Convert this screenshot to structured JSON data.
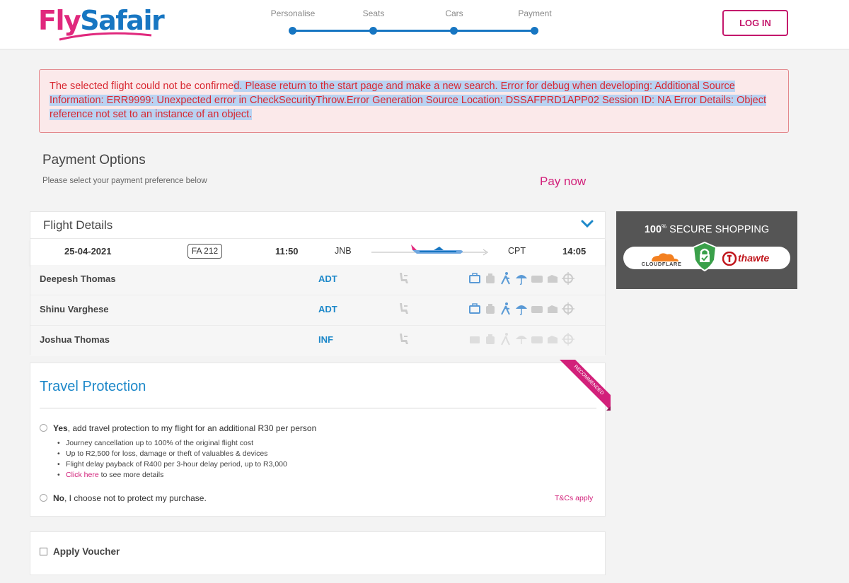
{
  "header": {
    "logo": {
      "part1": "Fly",
      "part2": "Safair"
    },
    "steps": [
      {
        "label": "Personalise"
      },
      {
        "label": "Seats"
      },
      {
        "label": "Cars"
      },
      {
        "label": "Payment"
      }
    ],
    "login_label": "LOG IN"
  },
  "error": {
    "text_plain": "The selected flight could not be confirme",
    "text_highlighted": "d. Please return to the start page and make a new search. Error for debug when developing: Additional Source Information: ERR9999: Unexpected error in CheckSecurityThrow.Error Generation Source Location: DSSAFPRD1APP02 Session ID: NA Error Details: Object reference not set to an instance of an object."
  },
  "payment": {
    "title": "Payment Options",
    "subtitle": "Please select your payment preference below",
    "pay_now": "Pay now"
  },
  "flight": {
    "title": "Flight Details",
    "date": "25-04-2021",
    "flight_no": "FA 212",
    "departure_time": "11:50",
    "from": "JNB",
    "to": "CPT",
    "arrival_time": "14:05"
  },
  "passengers": [
    {
      "name": "Deepesh Thomas",
      "type": "ADT",
      "services_active": true
    },
    {
      "name": "Shinu Varghese",
      "type": "ADT",
      "services_active": true
    },
    {
      "name": "Joshua Thomas",
      "type": "INF",
      "services_active": false
    }
  ],
  "secure": {
    "percent": "100",
    "percent_sup": "%",
    "label": "SECURE SHOPPING",
    "cloudflare": "CLOUDFLARE",
    "thawte": "thawte"
  },
  "protection": {
    "title": "Travel Protection",
    "ribbon": "RECOMMENDED",
    "yes_bold": "Yes",
    "yes_text": ", add travel protection to my flight for an additional R30 per person",
    "bullets": [
      "Journey cancellation up to 100% of the original flight cost",
      "Up to R2,500 for loss, damage or theft of valuables & devices",
      "Flight delay payback of R400 per 3-hour delay period, up to R3,000"
    ],
    "more_link": "Click here",
    "more_text": " to see more details",
    "no_bold": "No",
    "no_text": ", I choose not to protect my purchase.",
    "tcs": "T&Cs apply"
  },
  "voucher": {
    "label": "Apply Voucher"
  },
  "colors": {
    "brand_pink": "#e0287d",
    "brand_blue": "#1776c2",
    "error_red": "#d8262f",
    "link_pink": "#d2207a",
    "pax_type_blue": "#1d88c9"
  }
}
